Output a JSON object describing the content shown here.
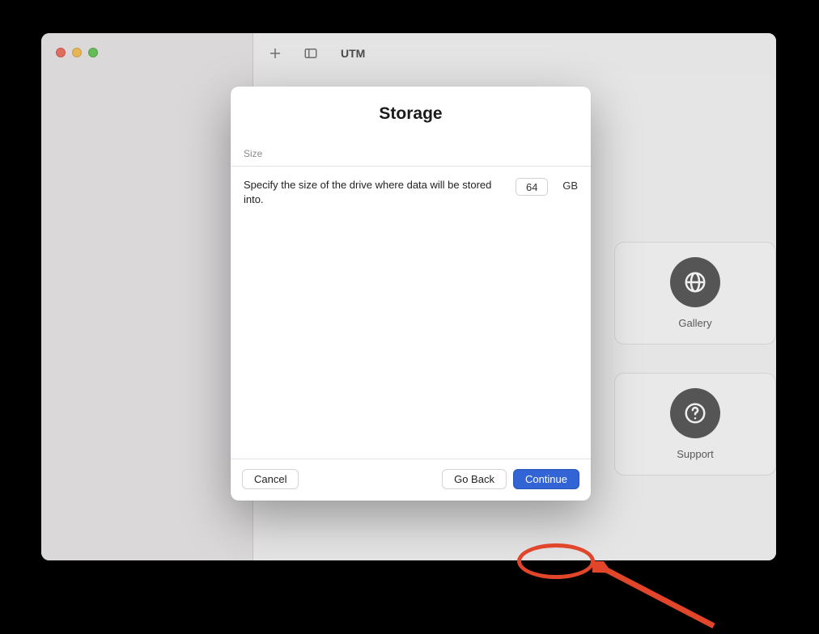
{
  "window": {
    "app_title": "UTM"
  },
  "background_cards": {
    "gallery_label": "Gallery",
    "support_label": "Support"
  },
  "sheet": {
    "title": "Storage",
    "section_header": "Size",
    "description": "Specify the size of the drive where data will be stored into.",
    "size_value": "64",
    "size_unit": "GB",
    "buttons": {
      "cancel": "Cancel",
      "go_back": "Go Back",
      "continue": "Continue"
    }
  }
}
